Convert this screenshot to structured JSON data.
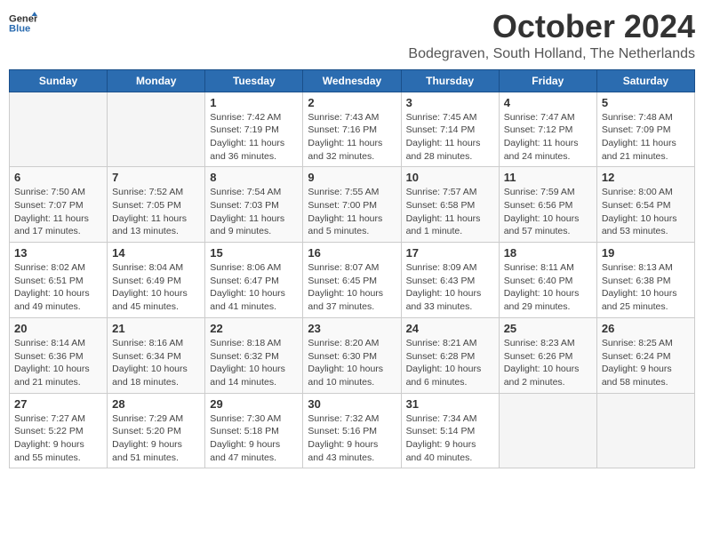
{
  "logo": {
    "line1": "General",
    "line2": "Blue"
  },
  "title": "October 2024",
  "location": "Bodegraven, South Holland, The Netherlands",
  "weekdays": [
    "Sunday",
    "Monday",
    "Tuesday",
    "Wednesday",
    "Thursday",
    "Friday",
    "Saturday"
  ],
  "weeks": [
    [
      {
        "day": "",
        "info": ""
      },
      {
        "day": "",
        "info": ""
      },
      {
        "day": "1",
        "info": "Sunrise: 7:42 AM\nSunset: 7:19 PM\nDaylight: 11 hours\nand 36 minutes."
      },
      {
        "day": "2",
        "info": "Sunrise: 7:43 AM\nSunset: 7:16 PM\nDaylight: 11 hours\nand 32 minutes."
      },
      {
        "day": "3",
        "info": "Sunrise: 7:45 AM\nSunset: 7:14 PM\nDaylight: 11 hours\nand 28 minutes."
      },
      {
        "day": "4",
        "info": "Sunrise: 7:47 AM\nSunset: 7:12 PM\nDaylight: 11 hours\nand 24 minutes."
      },
      {
        "day": "5",
        "info": "Sunrise: 7:48 AM\nSunset: 7:09 PM\nDaylight: 11 hours\nand 21 minutes."
      }
    ],
    [
      {
        "day": "6",
        "info": "Sunrise: 7:50 AM\nSunset: 7:07 PM\nDaylight: 11 hours\nand 17 minutes."
      },
      {
        "day": "7",
        "info": "Sunrise: 7:52 AM\nSunset: 7:05 PM\nDaylight: 11 hours\nand 13 minutes."
      },
      {
        "day": "8",
        "info": "Sunrise: 7:54 AM\nSunset: 7:03 PM\nDaylight: 11 hours\nand 9 minutes."
      },
      {
        "day": "9",
        "info": "Sunrise: 7:55 AM\nSunset: 7:00 PM\nDaylight: 11 hours\nand 5 minutes."
      },
      {
        "day": "10",
        "info": "Sunrise: 7:57 AM\nSunset: 6:58 PM\nDaylight: 11 hours\nand 1 minute."
      },
      {
        "day": "11",
        "info": "Sunrise: 7:59 AM\nSunset: 6:56 PM\nDaylight: 10 hours\nand 57 minutes."
      },
      {
        "day": "12",
        "info": "Sunrise: 8:00 AM\nSunset: 6:54 PM\nDaylight: 10 hours\nand 53 minutes."
      }
    ],
    [
      {
        "day": "13",
        "info": "Sunrise: 8:02 AM\nSunset: 6:51 PM\nDaylight: 10 hours\nand 49 minutes."
      },
      {
        "day": "14",
        "info": "Sunrise: 8:04 AM\nSunset: 6:49 PM\nDaylight: 10 hours\nand 45 minutes."
      },
      {
        "day": "15",
        "info": "Sunrise: 8:06 AM\nSunset: 6:47 PM\nDaylight: 10 hours\nand 41 minutes."
      },
      {
        "day": "16",
        "info": "Sunrise: 8:07 AM\nSunset: 6:45 PM\nDaylight: 10 hours\nand 37 minutes."
      },
      {
        "day": "17",
        "info": "Sunrise: 8:09 AM\nSunset: 6:43 PM\nDaylight: 10 hours\nand 33 minutes."
      },
      {
        "day": "18",
        "info": "Sunrise: 8:11 AM\nSunset: 6:40 PM\nDaylight: 10 hours\nand 29 minutes."
      },
      {
        "day": "19",
        "info": "Sunrise: 8:13 AM\nSunset: 6:38 PM\nDaylight: 10 hours\nand 25 minutes."
      }
    ],
    [
      {
        "day": "20",
        "info": "Sunrise: 8:14 AM\nSunset: 6:36 PM\nDaylight: 10 hours\nand 21 minutes."
      },
      {
        "day": "21",
        "info": "Sunrise: 8:16 AM\nSunset: 6:34 PM\nDaylight: 10 hours\nand 18 minutes."
      },
      {
        "day": "22",
        "info": "Sunrise: 8:18 AM\nSunset: 6:32 PM\nDaylight: 10 hours\nand 14 minutes."
      },
      {
        "day": "23",
        "info": "Sunrise: 8:20 AM\nSunset: 6:30 PM\nDaylight: 10 hours\nand 10 minutes."
      },
      {
        "day": "24",
        "info": "Sunrise: 8:21 AM\nSunset: 6:28 PM\nDaylight: 10 hours\nand 6 minutes."
      },
      {
        "day": "25",
        "info": "Sunrise: 8:23 AM\nSunset: 6:26 PM\nDaylight: 10 hours\nand 2 minutes."
      },
      {
        "day": "26",
        "info": "Sunrise: 8:25 AM\nSunset: 6:24 PM\nDaylight: 9 hours\nand 58 minutes."
      }
    ],
    [
      {
        "day": "27",
        "info": "Sunrise: 7:27 AM\nSunset: 5:22 PM\nDaylight: 9 hours\nand 55 minutes."
      },
      {
        "day": "28",
        "info": "Sunrise: 7:29 AM\nSunset: 5:20 PM\nDaylight: 9 hours\nand 51 minutes."
      },
      {
        "day": "29",
        "info": "Sunrise: 7:30 AM\nSunset: 5:18 PM\nDaylight: 9 hours\nand 47 minutes."
      },
      {
        "day": "30",
        "info": "Sunrise: 7:32 AM\nSunset: 5:16 PM\nDaylight: 9 hours\nand 43 minutes."
      },
      {
        "day": "31",
        "info": "Sunrise: 7:34 AM\nSunset: 5:14 PM\nDaylight: 9 hours\nand 40 minutes."
      },
      {
        "day": "",
        "info": ""
      },
      {
        "day": "",
        "info": ""
      }
    ]
  ]
}
